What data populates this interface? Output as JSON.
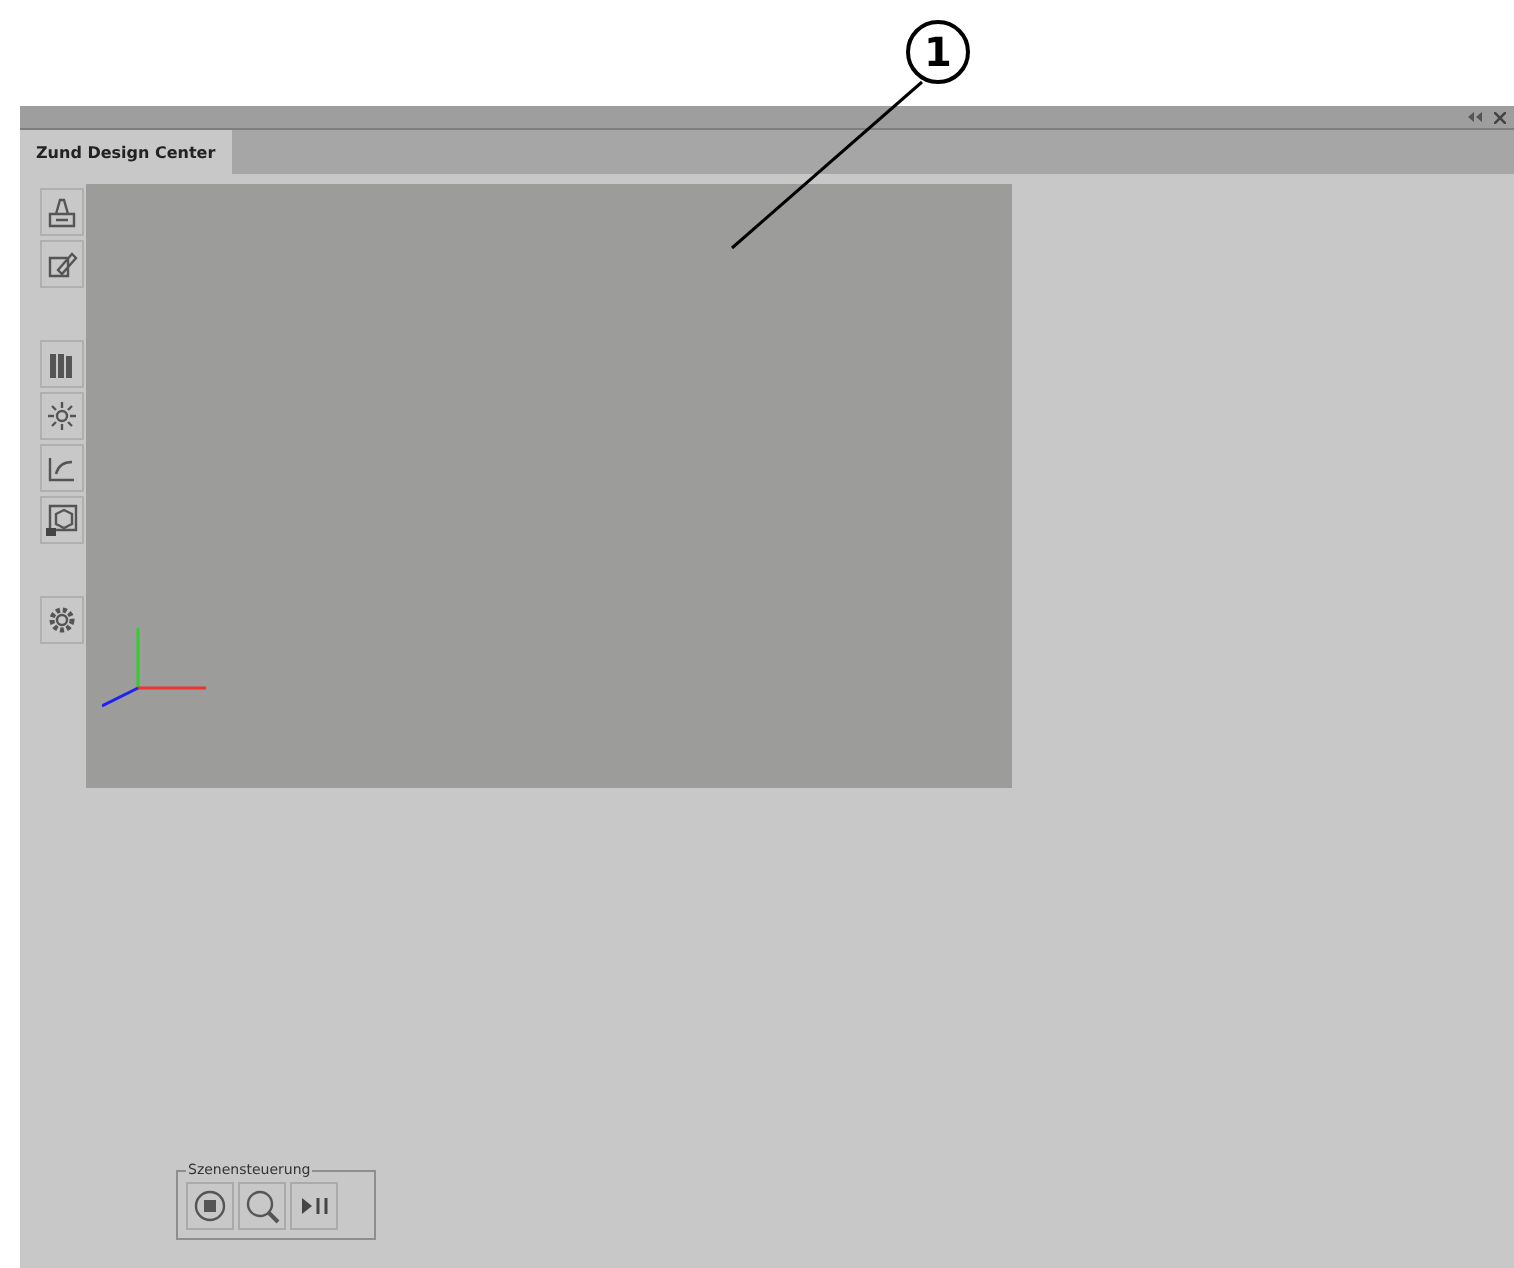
{
  "callout": {
    "label": "1"
  },
  "tabs": [
    {
      "label": "Zund Design Center",
      "selected": true
    }
  ],
  "scene_control": {
    "title": "Szenensteuerung"
  }
}
